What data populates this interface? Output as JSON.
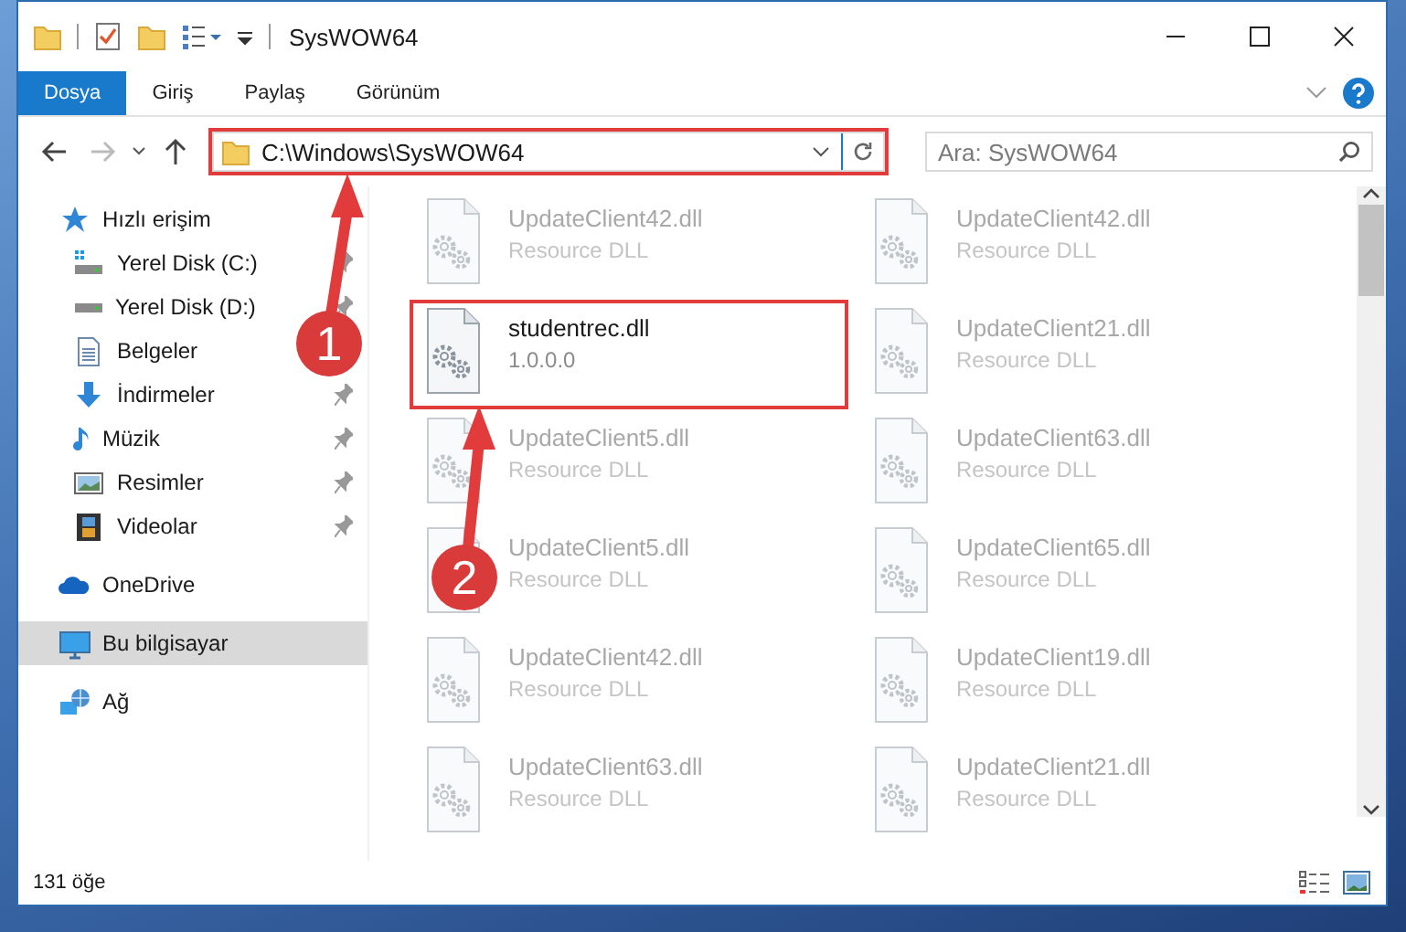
{
  "window": {
    "title": "SysWOW64"
  },
  "ribbon_tabs": [
    {
      "label": "Dosya",
      "kind": "file"
    },
    {
      "label": "Giriş",
      "kind": "tab"
    },
    {
      "label": "Paylaş",
      "kind": "tab"
    },
    {
      "label": "Görünüm",
      "kind": "tab"
    }
  ],
  "address_bar": {
    "path": "C:\\Windows\\SysWOW64",
    "highlighted": true
  },
  "search": {
    "placeholder": "Ara: SysWOW64"
  },
  "sidebar": {
    "items": [
      {
        "label": "Hızlı erişim",
        "kind": "quick-access",
        "selected": false,
        "children": [
          {
            "label": "Yerel Disk (C:)",
            "kind": "system-drive",
            "pinned": true,
            "selected": false
          },
          {
            "label": "Yerel Disk (D:)",
            "kind": "drive",
            "pinned": true,
            "selected": false
          },
          {
            "label": "Belgeler",
            "kind": "documents",
            "pinned": false,
            "selected": false
          },
          {
            "label": "İndirmeler",
            "kind": "downloads",
            "pinned": true,
            "selected": false
          },
          {
            "label": "Müzik",
            "kind": "music",
            "pinned": true,
            "selected": false
          },
          {
            "label": "Resimler",
            "kind": "pictures",
            "pinned": true,
            "selected": false
          },
          {
            "label": "Videolar",
            "kind": "videos",
            "pinned": true,
            "selected": false
          }
        ]
      },
      {
        "label": "OneDrive",
        "kind": "cloud",
        "selected": false
      },
      {
        "label": "Bu bilgisayar",
        "kind": "computer",
        "selected": true
      },
      {
        "label": "Ağ",
        "kind": "network",
        "selected": false
      }
    ]
  },
  "files": [
    {
      "name": "UpdateClient42.dll",
      "detail": "Resource DLL",
      "blurred": true,
      "highlighted": false
    },
    {
      "name": "UpdateClient42.dll",
      "detail": "Resource DLL",
      "blurred": true,
      "highlighted": false
    },
    {
      "name": "studentrec.dll",
      "detail": "1.0.0.0",
      "blurred": false,
      "highlighted": true
    },
    {
      "name": "UpdateClient21.dll",
      "detail": "Resource DLL",
      "blurred": true,
      "highlighted": false
    },
    {
      "name": "UpdateClient5.dll",
      "detail": "Resource DLL",
      "blurred": true,
      "highlighted": false
    },
    {
      "name": "UpdateClient63.dll",
      "detail": "Resource DLL",
      "blurred": true,
      "highlighted": false
    },
    {
      "name": "UpdateClient5.dll",
      "detail": "Resource DLL",
      "blurred": true,
      "highlighted": false
    },
    {
      "name": "UpdateClient65.dll",
      "detail": "Resource DLL",
      "blurred": true,
      "highlighted": false
    },
    {
      "name": "UpdateClient42.dll",
      "detail": "Resource DLL",
      "blurred": true,
      "highlighted": false
    },
    {
      "name": "UpdateClient19.dll",
      "detail": "Resource DLL",
      "blurred": true,
      "highlighted": false
    },
    {
      "name": "UpdateClient63.dll",
      "detail": "Resource DLL",
      "blurred": true,
      "highlighted": false
    },
    {
      "name": "UpdateClient21.dll",
      "detail": "Resource DLL",
      "blurred": true,
      "highlighted": false
    }
  ],
  "callouts": [
    {
      "label": "1"
    },
    {
      "label": "2"
    }
  ],
  "status_bar": {
    "item_count": "131 öğe"
  }
}
